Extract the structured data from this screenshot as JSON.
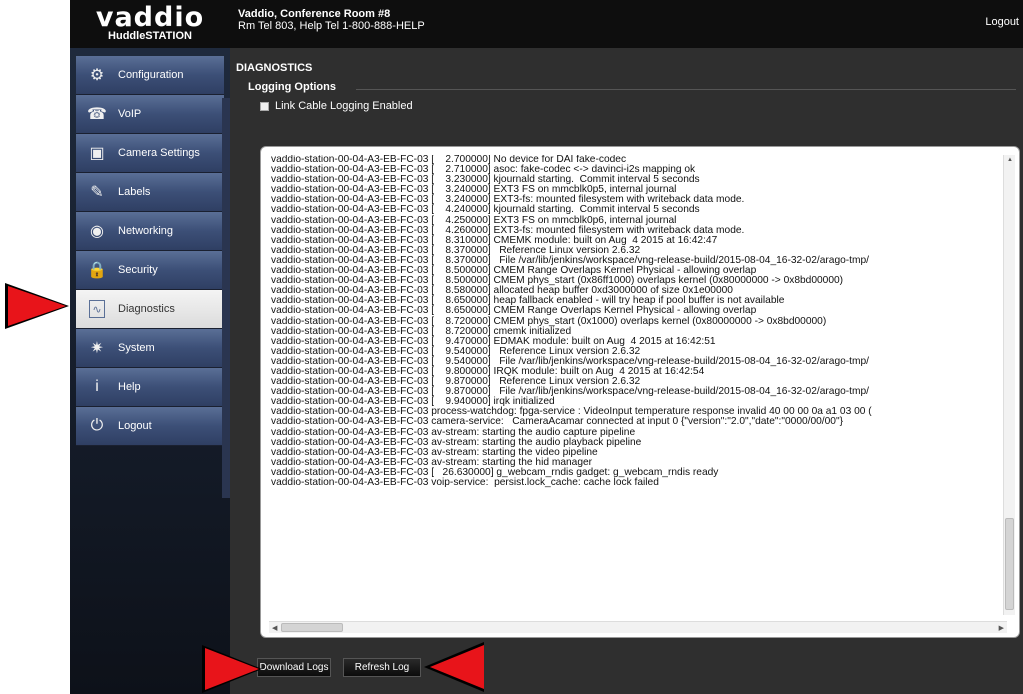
{
  "header": {
    "logo_word": "vaddio",
    "logo_product": "HuddleSTATION",
    "room_name": "Vaddio, Conference Room #8",
    "room_phones": "Rm Tel 803, Help Tel 1-800-888-HELP",
    "logout_label": "Logout"
  },
  "sidebar": {
    "items": [
      {
        "label": "Configuration",
        "icon": "tools-icon",
        "glyph": "⚙"
      },
      {
        "label": "VoIP",
        "icon": "phone-icon",
        "glyph": "☎"
      },
      {
        "label": "Camera Settings",
        "icon": "camera-icon",
        "glyph": "▣"
      },
      {
        "label": "Labels",
        "icon": "pencil-icon",
        "glyph": "✎"
      },
      {
        "label": "Networking",
        "icon": "globe-icon",
        "glyph": "◉"
      },
      {
        "label": "Security",
        "icon": "lock-icon",
        "glyph": "🔒"
      },
      {
        "label": "Diagnostics",
        "icon": "diagnostics-icon",
        "glyph": "∿",
        "active": true
      },
      {
        "label": "System",
        "icon": "gears-icon",
        "glyph": "✷"
      },
      {
        "label": "Help",
        "icon": "help-icon",
        "glyph": "i"
      },
      {
        "label": "Logout",
        "icon": "power-icon",
        "glyph": "⏻"
      }
    ]
  },
  "main": {
    "section_title": "DIAGNOSTICS",
    "subsection_title": "Logging Options",
    "checkbox_label": "Link Cable Logging Enabled",
    "checkbox_checked": false,
    "log_lines": [
      "vaddio-station-00-04-A3-EB-FC-03 [    2.700000] No device for DAI fake-codec",
      "vaddio-station-00-04-A3-EB-FC-03 [    2.710000] asoc: fake-codec <-> davinci-i2s mapping ok",
      "vaddio-station-00-04-A3-EB-FC-03 [    3.230000] kjournald starting.  Commit interval 5 seconds",
      "vaddio-station-00-04-A3-EB-FC-03 [    3.240000] EXT3 FS on mmcblk0p5, internal journal",
      "vaddio-station-00-04-A3-EB-FC-03 [    3.240000] EXT3-fs: mounted filesystem with writeback data mode.",
      "vaddio-station-00-04-A3-EB-FC-03 [    4.240000] kjournald starting.  Commit interval 5 seconds",
      "vaddio-station-00-04-A3-EB-FC-03 [    4.250000] EXT3 FS on mmcblk0p6, internal journal",
      "vaddio-station-00-04-A3-EB-FC-03 [    4.260000] EXT3-fs: mounted filesystem with writeback data mode.",
      "vaddio-station-00-04-A3-EB-FC-03 [    8.310000] CMEMK module: built on Aug  4 2015 at 16:42:47",
      "vaddio-station-00-04-A3-EB-FC-03 [    8.370000]   Reference Linux version 2.6.32",
      "vaddio-station-00-04-A3-EB-FC-03 [    8.370000]   File /var/lib/jenkins/workspace/vng-release-build/2015-08-04_16-32-02/arago-tmp/",
      "vaddio-station-00-04-A3-EB-FC-03 [    8.500000] CMEM Range Overlaps Kernel Physical - allowing overlap",
      "vaddio-station-00-04-A3-EB-FC-03 [    8.500000] CMEM phys_start (0x86ff1000) overlaps kernel (0x80000000 -> 0x8bd00000)",
      "vaddio-station-00-04-A3-EB-FC-03 [    8.580000] allocated heap buffer 0xd3000000 of size 0x1e00000",
      "vaddio-station-00-04-A3-EB-FC-03 [    8.650000] heap fallback enabled - will try heap if pool buffer is not available",
      "vaddio-station-00-04-A3-EB-FC-03 [    8.650000] CMEM Range Overlaps Kernel Physical - allowing overlap",
      "vaddio-station-00-04-A3-EB-FC-03 [    8.720000] CMEM phys_start (0x1000) overlaps kernel (0x80000000 -> 0x8bd00000)",
      "vaddio-station-00-04-A3-EB-FC-03 [    8.720000] cmemk initialized",
      "vaddio-station-00-04-A3-EB-FC-03 [    9.470000] EDMAK module: built on Aug  4 2015 at 16:42:51",
      "vaddio-station-00-04-A3-EB-FC-03 [    9.540000]   Reference Linux version 2.6.32",
      "vaddio-station-00-04-A3-EB-FC-03 [    9.540000]   File /var/lib/jenkins/workspace/vng-release-build/2015-08-04_16-32-02/arago-tmp/",
      "vaddio-station-00-04-A3-EB-FC-03 [    9.800000] IRQK module: built on Aug  4 2015 at 16:42:54",
      "vaddio-station-00-04-A3-EB-FC-03 [    9.870000]   Reference Linux version 2.6.32",
      "vaddio-station-00-04-A3-EB-FC-03 [    9.870000]   File /var/lib/jenkins/workspace/vng-release-build/2015-08-04_16-32-02/arago-tmp/",
      "vaddio-station-00-04-A3-EB-FC-03 [    9.940000] irqk initialized",
      "vaddio-station-00-04-A3-EB-FC-03 process-watchdog: fpga-service : VideoInput temperature response invalid 40 00 00 0a a1 03 00 (",
      "vaddio-station-00-04-A3-EB-FC-03 camera-service:   CameraAcamar connected at input 0 {\"version\":\"2.0\",\"date\":\"0000/00/00\"}",
      "vaddio-station-00-04-A3-EB-FC-03 av-stream: starting the audio capture pipeline",
      "vaddio-station-00-04-A3-EB-FC-03 av-stream: starting the audio playback pipeline",
      "vaddio-station-00-04-A3-EB-FC-03 av-stream: starting the video pipeline",
      "vaddio-station-00-04-A3-EB-FC-03 av-stream: starting the hid manager",
      "vaddio-station-00-04-A3-EB-FC-03 [   26.630000] g_webcam_rndis gadget: g_webcam_rndis ready",
      "vaddio-station-00-04-A3-EB-FC-03 voip-service:  persist.lock_cache: cache lock failed"
    ],
    "download_label": "Download Logs",
    "refresh_label": "Refresh Log"
  },
  "colors": {
    "accent_nav": "#3c4f77",
    "annotation_arrow": "#e8141a",
    "main_background": "#2f2f2f"
  }
}
